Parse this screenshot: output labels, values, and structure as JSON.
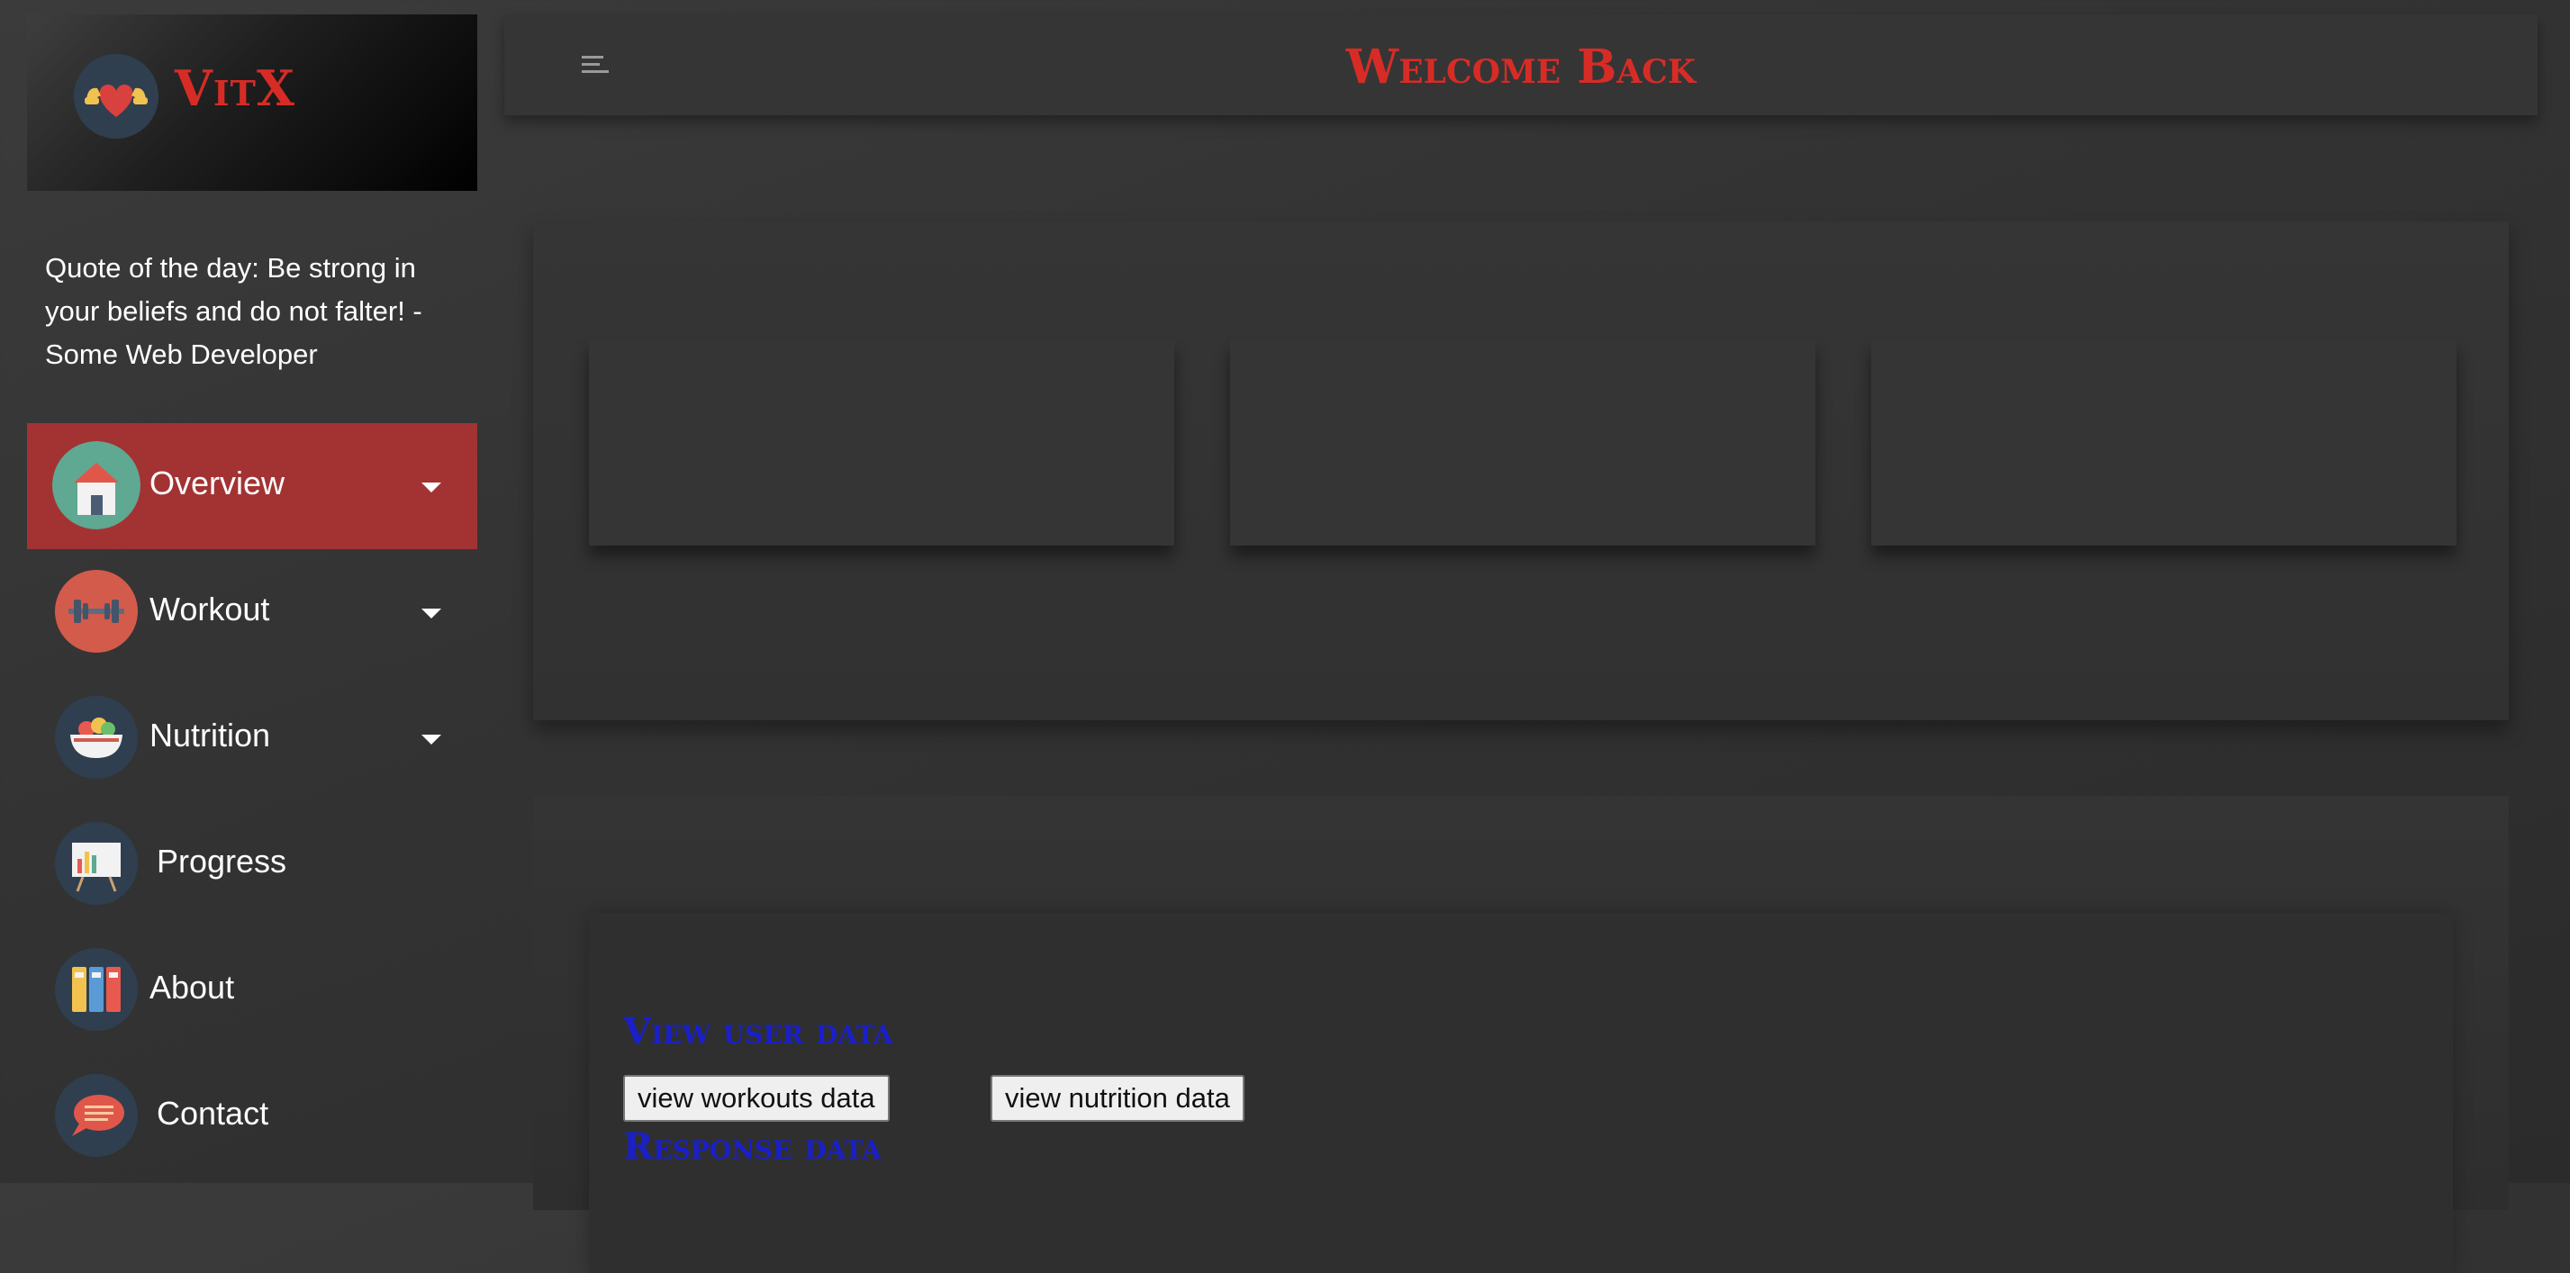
{
  "brand": {
    "name": "VitX",
    "logo_icon": "flexing-heart-icon"
  },
  "quote": "Quote of the day: Be strong in your beliefs and do not falter! - Some Web Developer",
  "nav": [
    {
      "label": "Overview",
      "icon": "home-icon",
      "has_dropdown": true,
      "active": true
    },
    {
      "label": "Workout",
      "icon": "dumbbell-icon",
      "has_dropdown": true
    },
    {
      "label": "Nutrition",
      "icon": "salad-bowl-icon",
      "has_dropdown": true
    },
    {
      "label": "Progress",
      "icon": "chart-easel-icon",
      "has_dropdown": false
    },
    {
      "label": "About",
      "icon": "binders-icon",
      "has_dropdown": false
    },
    {
      "label": "Contact",
      "icon": "chat-bubble-icon",
      "has_dropdown": false
    }
  ],
  "header": {
    "title": "Welcome Back",
    "menu_icon": "menu-icon"
  },
  "data_section": {
    "title": "View user data",
    "buttons": {
      "workouts": "view workouts data",
      "nutrition": "view nutrition data"
    },
    "response_title": "Response data"
  },
  "colors": {
    "accent_red": "#d72c26",
    "active_nav": "#a33333",
    "link_blue": "#1a20c8"
  }
}
